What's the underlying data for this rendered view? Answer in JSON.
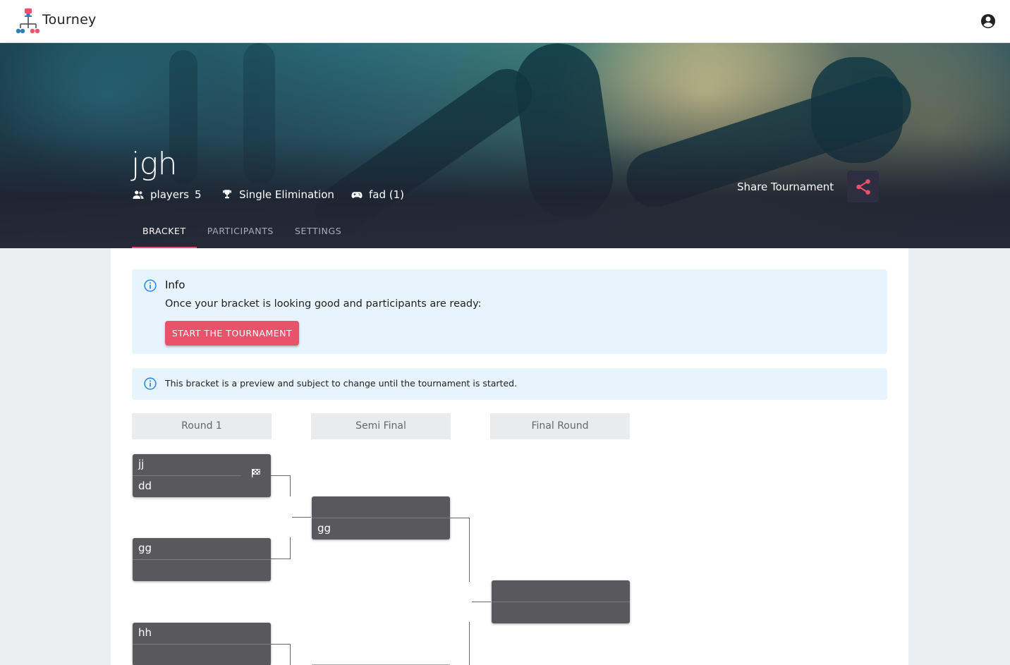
{
  "app": {
    "brand": "Tourney"
  },
  "tournament": {
    "title": "jgh",
    "players_label": "players",
    "players_count": "5",
    "format": "Single Elimination",
    "game": "fad (1)",
    "share_label": "Share Tournament"
  },
  "tabs": [
    {
      "label": "BRACKET",
      "active": true
    },
    {
      "label": "PARTICIPANTS",
      "active": false
    },
    {
      "label": "SETTINGS",
      "active": false
    }
  ],
  "info_alert": {
    "title": "Info",
    "message": "Once your bracket is looking good and participants are ready:",
    "button": "START THE TOURNAMENT"
  },
  "preview_alert": {
    "message": "This bracket is a preview and subject to change until the tournament is started."
  },
  "rounds": [
    "Round 1",
    "Semi Final",
    "Final Round"
  ],
  "matches": {
    "r1": [
      {
        "top": "jj",
        "bottom": "dd",
        "flag": true
      },
      {
        "top": "gg",
        "bottom": ""
      },
      {
        "top": "hh",
        "bottom": ""
      }
    ],
    "semi": [
      {
        "top": "",
        "bottom": "gg"
      }
    ],
    "final": [
      {
        "top": "",
        "bottom": ""
      }
    ]
  },
  "colors": {
    "accent": "#e8526a",
    "match_bg": "#58585d",
    "alert_bg": "#e8f4fd",
    "info_icon": "#1e88e5"
  }
}
